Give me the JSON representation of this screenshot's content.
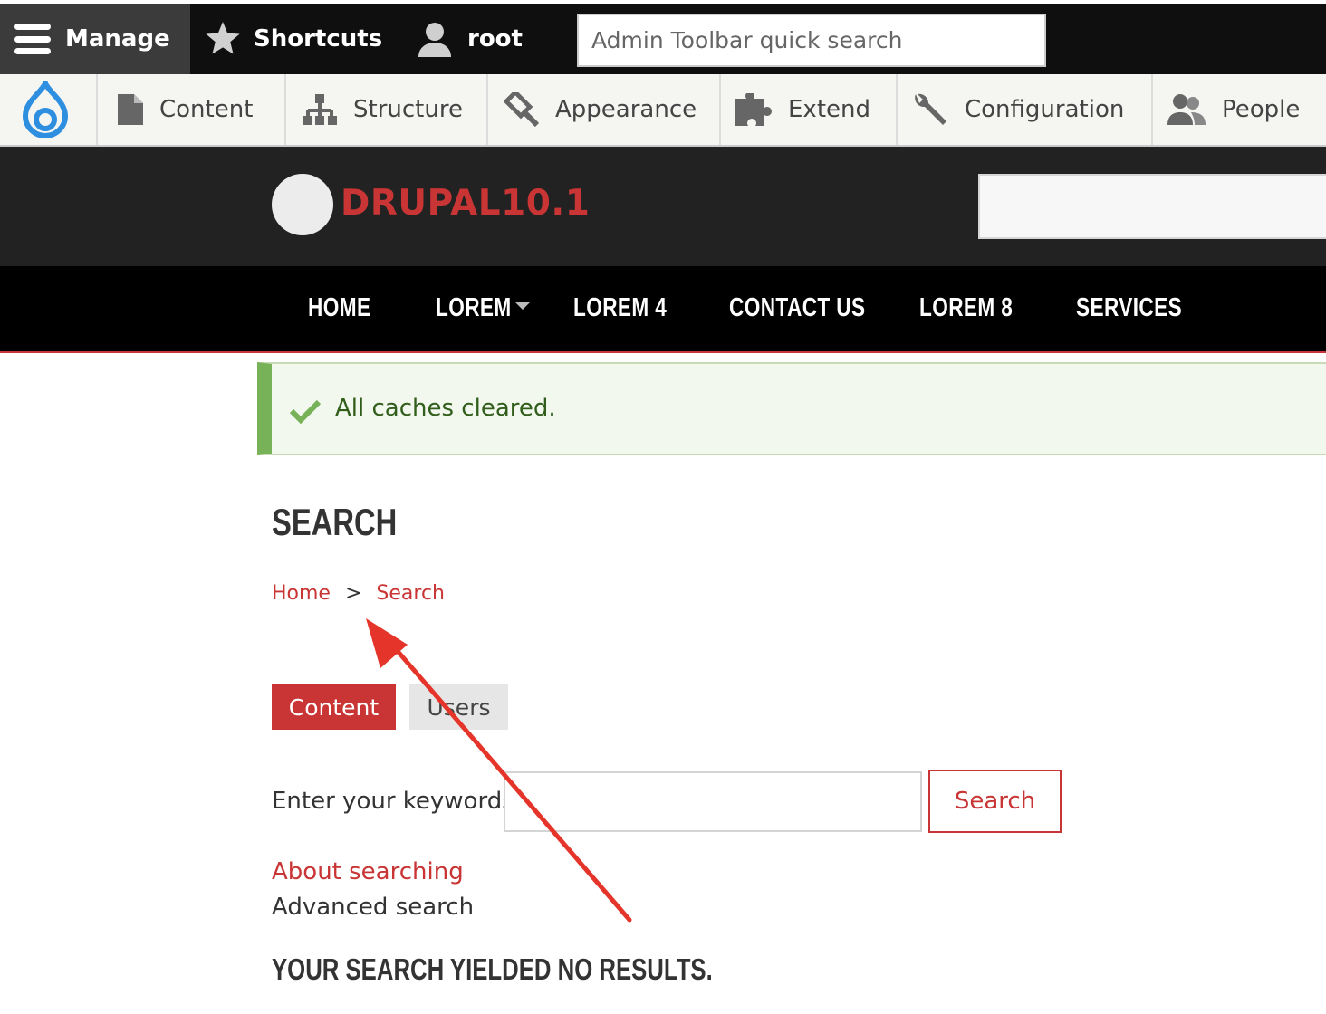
{
  "admin_toolbar": {
    "manage_label": "Manage",
    "shortcuts_label": "Shortcuts",
    "user_label": "root",
    "quick_search_placeholder": "Admin Toolbar quick search"
  },
  "admin_tray": {
    "home_icon": "drupal-drop-icon",
    "items": [
      {
        "label": "Content",
        "icon": "file-icon"
      },
      {
        "label": "Structure",
        "icon": "sitemap-icon"
      },
      {
        "label": "Appearance",
        "icon": "paintbrush-icon"
      },
      {
        "label": "Extend",
        "icon": "puzzle-icon"
      },
      {
        "label": "Configuration",
        "icon": "wrench-icon"
      },
      {
        "label": "People",
        "icon": "people-icon"
      }
    ]
  },
  "site": {
    "name": "DRUPAL10.1"
  },
  "main_menu": {
    "items": [
      "HOME",
      "LOREM",
      "LOREM 4",
      "CONTACT US",
      "LOREM 8",
      "SERVICES"
    ]
  },
  "status_message": {
    "text": "All caches cleared.",
    "icon": "checkmark-icon"
  },
  "page": {
    "title": "SEARCH",
    "breadcrumb": {
      "home": "Home",
      "separator": ">",
      "current": "Search"
    },
    "tabs": [
      {
        "label": "Content",
        "active": true
      },
      {
        "label": "Users",
        "active": false
      }
    ],
    "form": {
      "keywords_label": "Enter your keywords",
      "keywords_value": "",
      "submit_label": "Search"
    },
    "about_link": "About searching",
    "advanced_text": "Advanced search",
    "no_results": "YOUR SEARCH YIELDED NO RESULTS."
  },
  "colors": {
    "accent": "#c93535",
    "toolbar_bg": "#0f0f0f",
    "status_green": "#77b259",
    "annotation_arrow": "#e5352b"
  }
}
